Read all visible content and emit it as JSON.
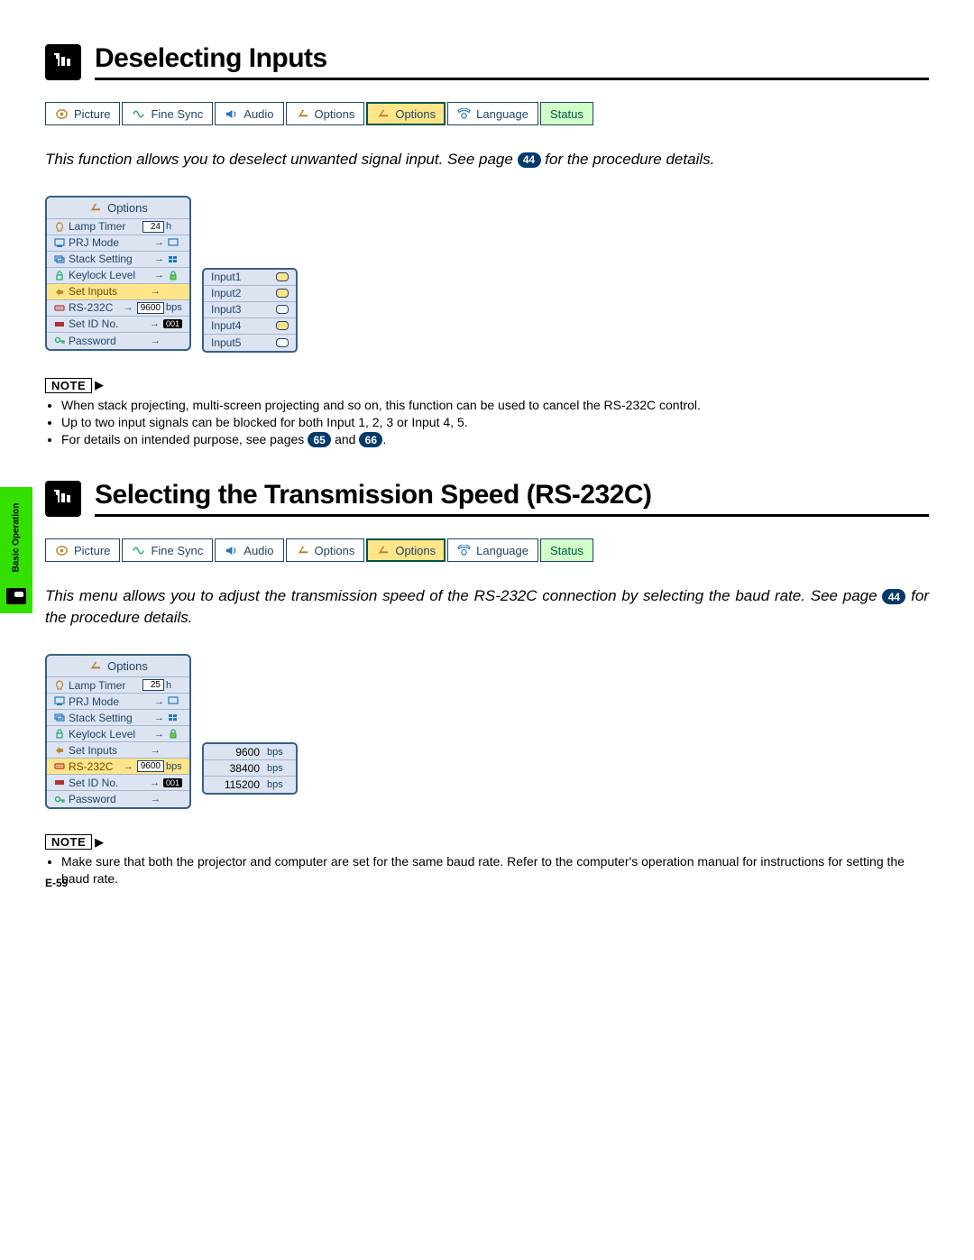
{
  "side_tab": {
    "label": "Basic Operation"
  },
  "sections": {
    "deselecting_inputs": {
      "title": "Deselecting Inputs",
      "desc_prefix": "This function allows you to deselect unwanted signal input. See page ",
      "desc_page": "44",
      "desc_suffix": " for the procedure details.",
      "notes": [
        "When stack projecting, multi-screen projecting and so on, this function can be used to cancel the RS-232C control.",
        "Up to two input signals can be blocked for both Input 1, 2, 3 or Input 4, 5."
      ],
      "note3_prefix": "For details on intended purpose, see pages ",
      "note3_p1": "65",
      "note3_mid": " and ",
      "note3_p2": "66",
      "note3_suffix": "."
    },
    "transmission_speed": {
      "title": "Selecting the Transmission Speed (RS-232C)",
      "desc_prefix": "This menu allows you to adjust the transmission speed of the RS-232C connection by selecting the baud rate. See page ",
      "desc_page": "44",
      "desc_suffix": " for the procedure details.",
      "notes": [
        "Make sure that both the projector and computer are set for the same baud rate. Refer to the computer's operation manual for instructions for setting the baud rate."
      ]
    }
  },
  "menu": {
    "picture": "Picture",
    "fine_sync": "Fine Sync",
    "audio": "Audio",
    "options1": "Options",
    "options2": "Options",
    "language": "Language",
    "status": "Status"
  },
  "osd": {
    "header": "Options",
    "rows": {
      "lamp_timer": {
        "label": "Lamp Timer",
        "value": "24",
        "unit": "h"
      },
      "prj_mode": {
        "label": "PRJ Mode"
      },
      "stack_setting": {
        "label": "Stack Setting"
      },
      "keylock": {
        "label": "Keylock Level"
      },
      "set_inputs": {
        "label": "Set Inputs"
      },
      "rs232c": {
        "label": "RS-232C",
        "value": "9600",
        "unit": "bps"
      },
      "set_id": {
        "label": "Set ID No.",
        "value": "001"
      },
      "password": {
        "label": "Password"
      }
    }
  },
  "osd2": {
    "rows": {
      "lamp_timer": {
        "value": "25",
        "unit": "h"
      }
    }
  },
  "inputs_popup": {
    "rows": [
      "Input1",
      "Input2",
      "Input3",
      "Input4",
      "Input5"
    ]
  },
  "bps_popup": {
    "rows": [
      {
        "value": "9600",
        "unit": "bps"
      },
      {
        "value": "38400",
        "unit": "bps"
      },
      {
        "value": "115200",
        "unit": "bps"
      }
    ]
  },
  "labels": {
    "note": "NOTE"
  },
  "page_number": "E-59"
}
